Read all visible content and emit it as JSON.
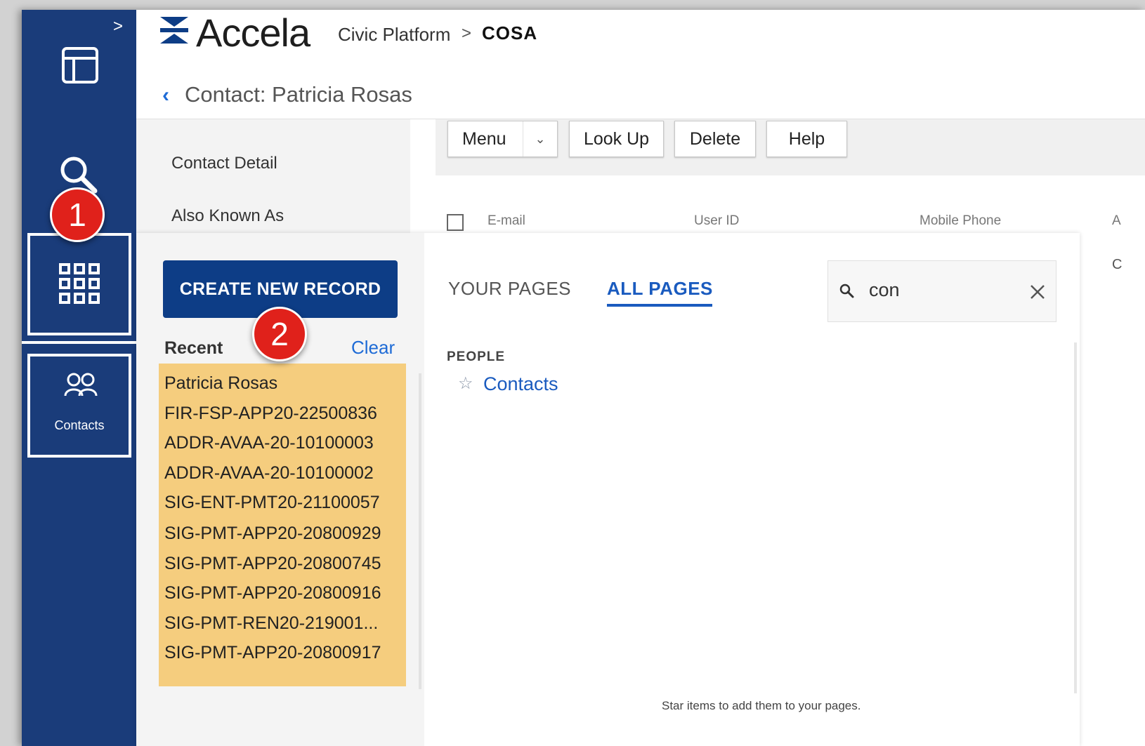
{
  "header": {
    "logo_text": "Accela",
    "breadcrumb_root": "Civic Platform",
    "breadcrumb_sep": ">",
    "breadcrumb_current": "COSA"
  },
  "page": {
    "back_chevron": "‹",
    "title": "Contact: Patricia Rosas"
  },
  "rail": {
    "expand": ">",
    "contacts_label": "Contacts"
  },
  "subnav": {
    "items": [
      "Contact Detail",
      "Also Known As"
    ]
  },
  "toolbar": {
    "menu": "Menu",
    "lookup": "Look Up",
    "delete": "Delete",
    "help": "Help"
  },
  "table": {
    "headers": [
      "E-mail",
      "User ID",
      "Mobile Phone",
      "A"
    ],
    "row_partial": "C"
  },
  "launcher": {
    "create_button": "CREATE NEW RECORD",
    "recent_label": "Recent",
    "clear_label": "Clear",
    "recent_items": [
      "Patricia Rosas",
      "FIR-FSP-APP20-22500836",
      "ADDR-AVAA-20-10100003",
      "ADDR-AVAA-20-10100002",
      "SIG-ENT-PMT20-21100057",
      "SIG-PMT-APP20-20800929",
      "SIG-PMT-APP20-20800745",
      "SIG-PMT-APP20-20800916",
      "SIG-PMT-REN20-219001...",
      "SIG-PMT-APP20-20800917"
    ],
    "tabs": {
      "your_pages": "YOUR PAGES",
      "all_pages": "ALL PAGES"
    },
    "search_value": "con",
    "group_label": "PEOPLE",
    "result_link": "Contacts",
    "hint": "Star items to add them to your pages."
  },
  "badges": {
    "one": "1",
    "two": "2"
  },
  "colors": {
    "rail": "#1a3c7a",
    "primary_button": "#0d3d86",
    "link": "#1a5bbf",
    "recent_highlight": "#f5cd7e",
    "badge": "#e0211b"
  },
  "icons": [
    "layout-icon",
    "search-icon",
    "apps-grid-icon",
    "contacts-icon",
    "chevron-right-icon",
    "search-small-icon",
    "close-icon",
    "star-icon",
    "chevron-down-icon"
  ]
}
